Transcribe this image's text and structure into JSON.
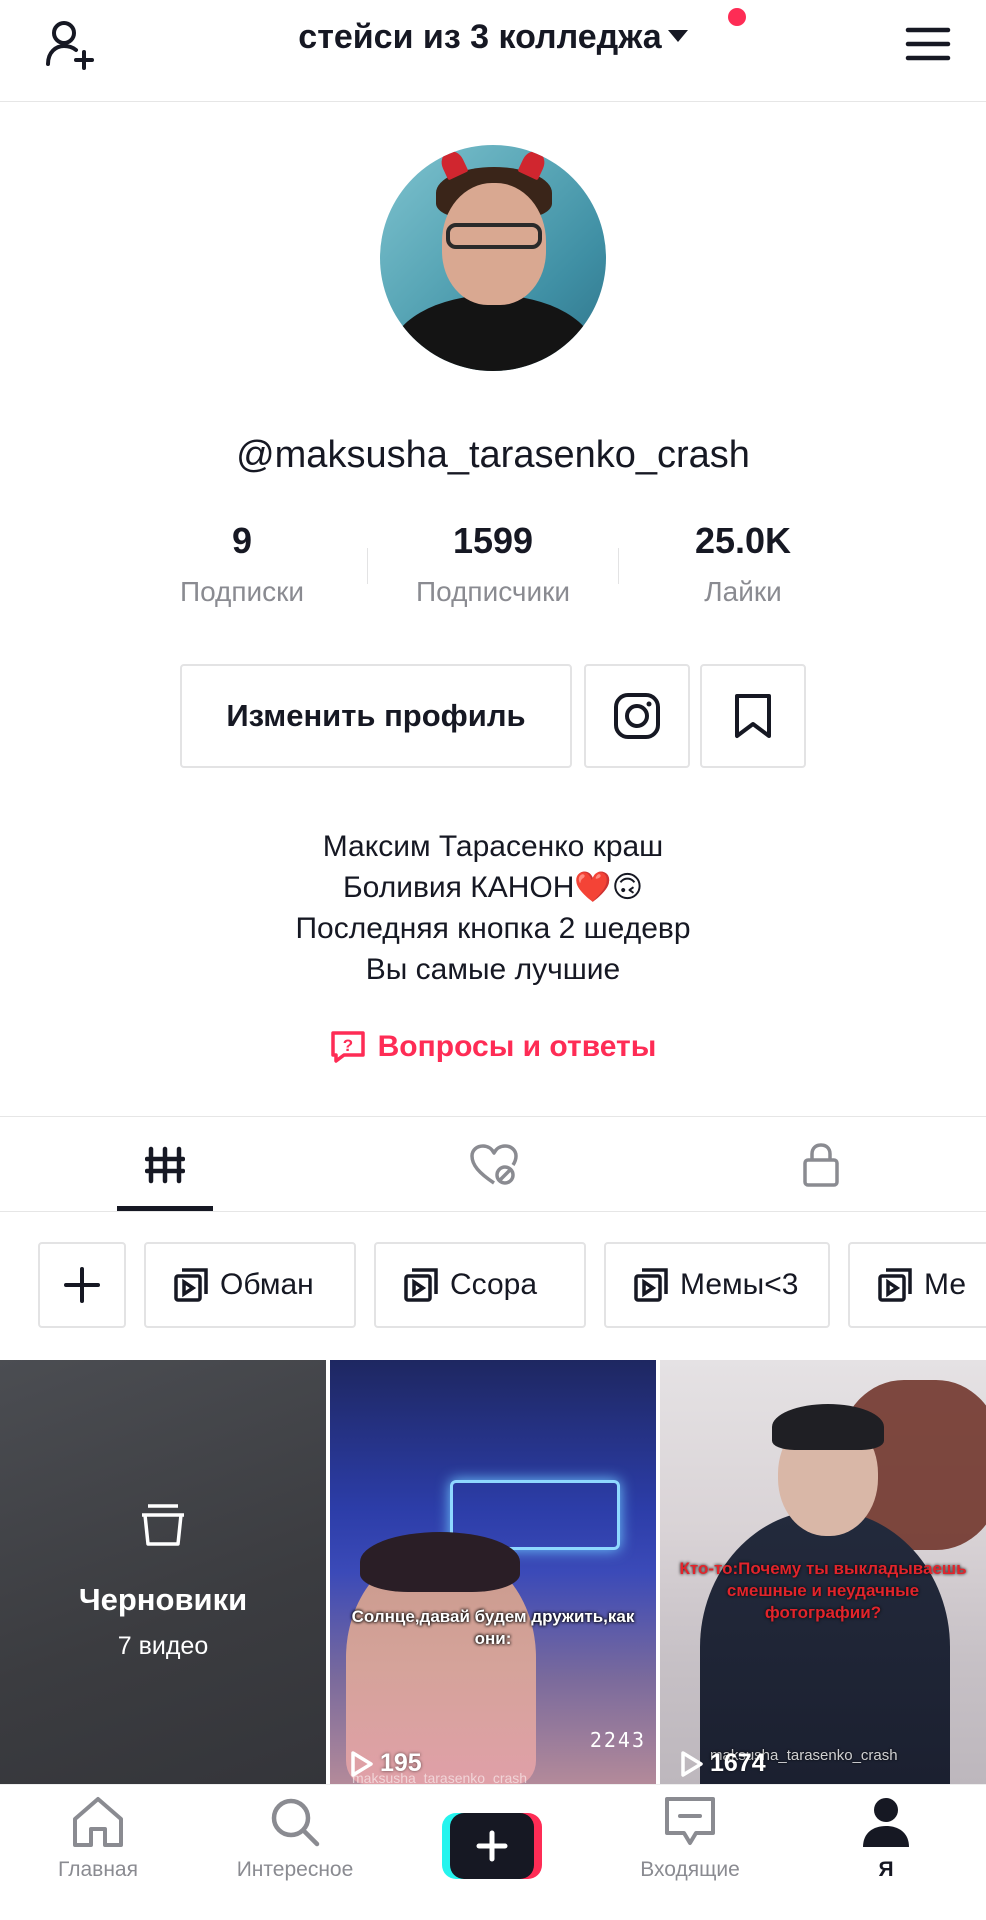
{
  "header": {
    "title": "стейси из 3 колледжа",
    "notification_dot_color": "#fe2c55"
  },
  "profile": {
    "username": "@maksusha_tarasenko_crash",
    "stats": [
      {
        "value": "9",
        "label": "Подписки"
      },
      {
        "value": "1599",
        "label": "Подписчики"
      },
      {
        "value": "25.0K",
        "label": "Лайки"
      }
    ],
    "edit_button": "Изменить профиль",
    "bio": [
      "Максим Тарасенко краш",
      "Боливия КАНОН❤️🙃",
      "Последняя кнопка 2 шедевр",
      "Вы самые лучшие"
    ],
    "qa_link": "Вопросы и ответы"
  },
  "tabs": [
    {
      "icon": "grid-icon",
      "active": true
    },
    {
      "icon": "liked-hidden-icon",
      "active": false
    },
    {
      "icon": "lock-icon",
      "active": false
    }
  ],
  "playlists": [
    "Обман",
    "Ссора",
    "Мемы<3",
    "Ме"
  ],
  "videos": {
    "drafts": {
      "title": "Черновики",
      "subtitle": "7 видео"
    },
    "items": [
      {
        "caption": "Солнце,давай будем дружить,как они:",
        "plays": "195",
        "overlay_number": "2243",
        "watermark": "maksusha_tarasenko_crash"
      },
      {
        "caption": "Кто-то:Почему ты выкладываешь смешные и неудачные фотографии?",
        "plays": "1674",
        "watermark": "maksusha_tarasenko_crash"
      }
    ]
  },
  "nav": [
    {
      "label": "Главная",
      "icon": "home-icon"
    },
    {
      "label": "Интересное",
      "icon": "search-icon"
    },
    {
      "label": "",
      "icon": "create-icon"
    },
    {
      "label": "Входящие",
      "icon": "inbox-icon"
    },
    {
      "label": "Я",
      "icon": "profile-icon",
      "active": true
    }
  ],
  "colors": {
    "accent": "#fe2c55",
    "text": "#161823",
    "secondary": "#8a8b91"
  }
}
